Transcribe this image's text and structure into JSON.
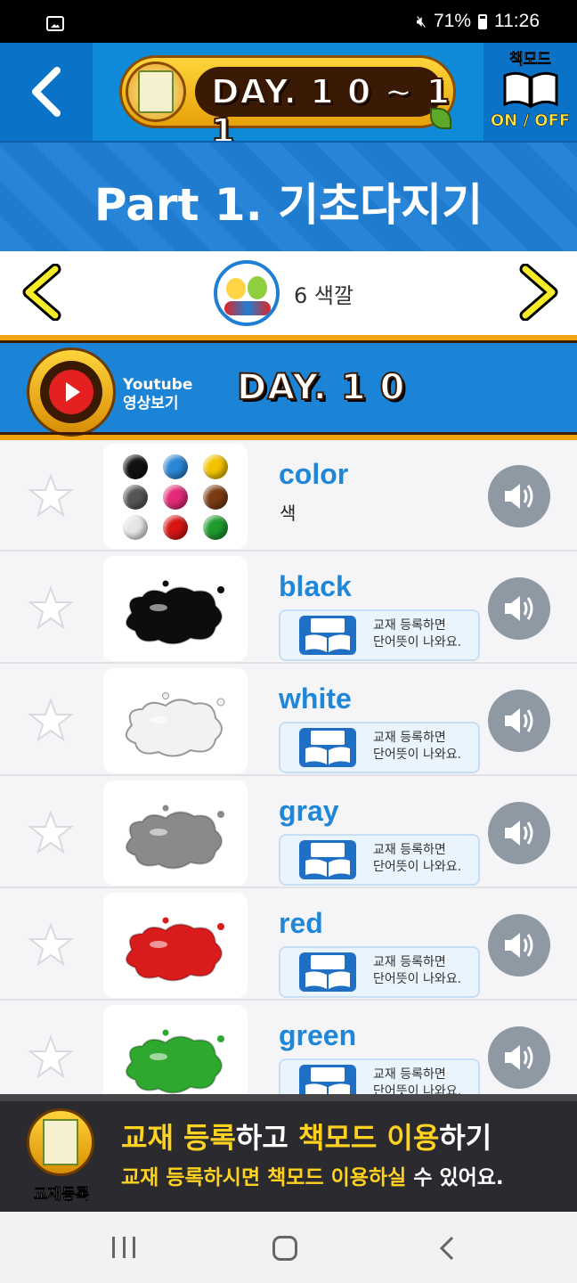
{
  "status_bar": {
    "battery": "71%",
    "time": "11:26"
  },
  "header": {
    "day_range": "DAY. 1 0 ~ 1 1",
    "bookmode_label": "책모드",
    "bookmode_toggle": "ON / OFF"
  },
  "part_title": "Part 1. 기초다지기",
  "lesson": {
    "number": "6",
    "name": "색깔",
    "label": "6  색깔"
  },
  "youtube": {
    "line1": "Youtube",
    "line2": "영상보기",
    "day": "DAY. 1 0"
  },
  "words": [
    {
      "word": "color",
      "meaning": "색",
      "thumb": "color-dots"
    },
    {
      "word": "black",
      "notice": [
        "교재 등록하면",
        "단어뜻이 나와요."
      ],
      "color": "#0d0d0d"
    },
    {
      "word": "white",
      "notice": [
        "교재 등록하면",
        "단어뜻이 나와요."
      ],
      "color": "#f2f2f2"
    },
    {
      "word": "gray",
      "notice": [
        "교재 등록하면",
        "단어뜻이 나와요."
      ],
      "color": "#8a8a8a"
    },
    {
      "word": "red",
      "notice": [
        "교재 등록하면",
        "단어뜻이 나와요."
      ],
      "color": "#d81c1c"
    },
    {
      "word": "green",
      "notice": [
        "교재 등록하면",
        "단어뜻이 나와요."
      ],
      "color": "#2ea82e"
    }
  ],
  "notice_badge": "책모드",
  "color_dots": [
    "#111111",
    "#2a86d6",
    "#f2c300",
    "#555555",
    "#e22a78",
    "#7a3b12",
    "#e6e6e6",
    "#d81414",
    "#1f9a2e"
  ],
  "banner": {
    "cover_label": "교재등록",
    "line1_a": "교재 등록",
    "line1_b": "하고 ",
    "line1_c": "책모드 이용",
    "line1_d": "하기",
    "line2_a": "교재 등록하시면 책모드 이용하실",
    "line2_b": " 수 있어요."
  }
}
